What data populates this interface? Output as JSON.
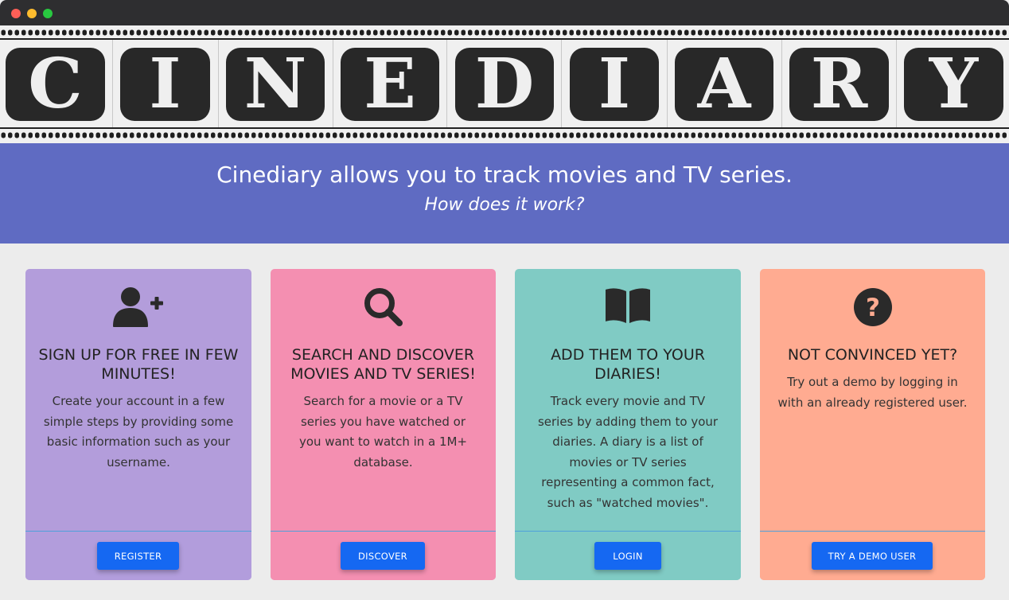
{
  "window": {
    "controls": [
      "close",
      "minimize",
      "maximize"
    ]
  },
  "logo": {
    "text": "CINEDIARY",
    "letters": [
      "C",
      "I",
      "N",
      "E",
      "D",
      "I",
      "A",
      "R",
      "Y"
    ]
  },
  "banner": {
    "title": "Cinediary allows you to track movies and TV series.",
    "subtitle": "How does it work?"
  },
  "cards": [
    {
      "icon": "user-plus-icon",
      "title": "SIGN UP FOR FREE IN FEW MINUTES!",
      "text": "Create your account in a few simple steps by providing some basic information such as your username.",
      "button": "REGISTER",
      "color": "#b39ddb",
      "footer_color": "#b29ddc"
    },
    {
      "icon": "search-icon",
      "title": "SEARCH AND DISCOVER MOVIES AND TV SERIES!",
      "text": "Search for a movie or a TV series you have watched or you want to watch in a 1M+ database.",
      "button": "DISCOVER",
      "color": "#f48fb1",
      "footer_color": "#f48fb1"
    },
    {
      "icon": "book-open-icon",
      "title": "ADD THEM TO YOUR DIARIES!",
      "text": "Track every movie and TV series by adding them to your diaries. A diary is a list of movies or TV series representing a common fact, such as \"watched movies\".",
      "button": "LOGIN",
      "color": "#80cbc4",
      "footer_color": "#80cbc4"
    },
    {
      "icon": "question-circle-icon",
      "title": "NOT CONVINCED YET?",
      "text": "Try out a demo by logging in with an already registered user.",
      "button": "TRY A DEMO USER",
      "color": "#ffab91",
      "footer_color": "#ffab91"
    }
  ],
  "colors": {
    "banner": "#5f6bc2",
    "button": "#1568f2",
    "page_background": "#ececec",
    "logo_tile": "#282828"
  }
}
